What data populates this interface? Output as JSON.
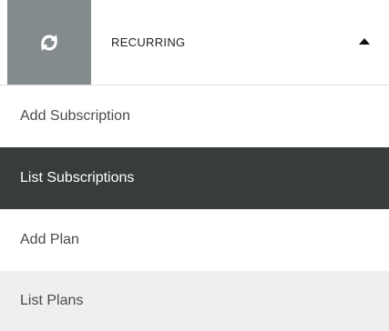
{
  "menu": {
    "header": {
      "icon": "refresh-icon",
      "label": "RECURRING",
      "toggle_icon": "caret-up-icon",
      "expanded": true
    },
    "items": [
      {
        "label": "Add Subscription",
        "state": "normal"
      },
      {
        "label": "List Subscriptions",
        "state": "active"
      },
      {
        "label": "Add Plan",
        "state": "normal"
      },
      {
        "label": "List Plans",
        "state": "hover"
      }
    ]
  },
  "colors": {
    "icon_box": "#838b8c",
    "active_bg": "#393c3c",
    "hover_bg": "#efefef",
    "text": "#4a4a4a"
  }
}
